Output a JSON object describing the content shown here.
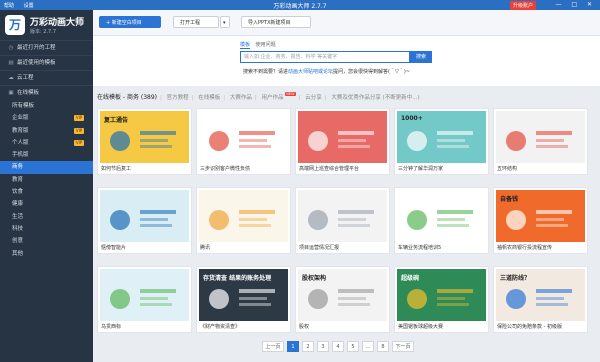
{
  "titlebar": {
    "menu": [
      "帮助",
      "设置"
    ],
    "title": "万彩动画大师 2.7.7",
    "upgrade": "升级账户",
    "controls": "— □ ✕"
  },
  "app": {
    "logo_char": "万",
    "name": "万彩动画大师",
    "version": "版本: 2.7.7"
  },
  "sidebar": {
    "nav": [
      {
        "label": "最近打开的工程",
        "icon": "clock-icon"
      },
      {
        "label": "最近使用的模板",
        "icon": "template-icon"
      },
      {
        "label": "云工程",
        "icon": "cloud-icon"
      },
      {
        "label": "在线模板",
        "icon": "folder-icon"
      }
    ],
    "categories": [
      {
        "label": "所有模板",
        "vip": false
      },
      {
        "label": "企业版",
        "vip": true
      },
      {
        "label": "教育版",
        "vip": true
      },
      {
        "label": "个人版",
        "vip": true
      },
      {
        "label": "手机版",
        "vip": false
      },
      {
        "label": "商务",
        "vip": false,
        "active": true
      },
      {
        "label": "教育",
        "vip": false
      },
      {
        "label": "饮食",
        "vip": false
      },
      {
        "label": "健康",
        "vip": false
      },
      {
        "label": "生活",
        "vip": false
      },
      {
        "label": "科技",
        "vip": false
      },
      {
        "label": "创意",
        "vip": false
      },
      {
        "label": "其他",
        "vip": false
      }
    ],
    "vip_label": "VIP"
  },
  "toolbar": {
    "new": "+ 新建空白项目",
    "open": "打开工程",
    "dropdown": "▾",
    "import": "导入PPTX新建项目"
  },
  "search": {
    "tabs": [
      "模板",
      "使用问题"
    ],
    "placeholder": "输入如:企业、商务、报告、科学 等关键字",
    "button": "搜索",
    "hint_prefix": "搜索不到需要？请进",
    "hint_link": "动画大师贴吧或论坛",
    "hint_suffix": "提问，您会很快得到解答(＾▽＾)~"
  },
  "filter": {
    "current": "在线模板 - 商务 (389)",
    "links": [
      "官方教程",
      "在线模板",
      "大赛作品",
      "用户作品",
      "云分享",
      "大赛及优秀作品分享 (不断更新中...)"
    ],
    "hot": "NEW"
  },
  "templates": [
    {
      "label": "如何节后复工",
      "thumb_text": "复工通告"
    },
    {
      "label": "三步识别客户微性负债",
      "thumb_text": ""
    },
    {
      "label": "高端网上巡查综合管理平台",
      "thumb_text": ""
    },
    {
      "label": "三分钟了解华润万家",
      "thumb_text": "1000+"
    },
    {
      "label": "五环结构",
      "thumb_text": ""
    },
    {
      "label": "惬傍智能片",
      "thumb_text": ""
    },
    {
      "label": "腾讯",
      "thumb_text": ""
    },
    {
      "label": "项目运营情况汇报",
      "thumb_text": ""
    },
    {
      "label": "车辆业务流程培训5",
      "thumb_text": ""
    },
    {
      "label": "袖帆农商银行投流程宣传",
      "thumb_text": "自备钱"
    },
    {
      "label": "乌贯西标",
      "thumb_text": ""
    },
    {
      "label": "《财产物资清查》",
      "thumb_text": "存货清查 结果的账务处理"
    },
    {
      "label": "股权",
      "thumb_text": "股权架构"
    },
    {
      "label": "美国锯板球超级大赛",
      "thumb_text": "超级碗"
    },
    {
      "label": "保险公司的免赔条款 - 初级版",
      "thumb_text": "三道防线？"
    }
  ],
  "pager": {
    "prev": "上一页",
    "next": "下一页",
    "pages": [
      "1",
      "2",
      "3",
      "4",
      "5",
      "...",
      "8"
    ],
    "active": "1"
  },
  "colors": {
    "accent": "#2b74d4",
    "sidebar": "#263443",
    "titlebar": "#2a6fc1",
    "vip": "#f5b731"
  }
}
